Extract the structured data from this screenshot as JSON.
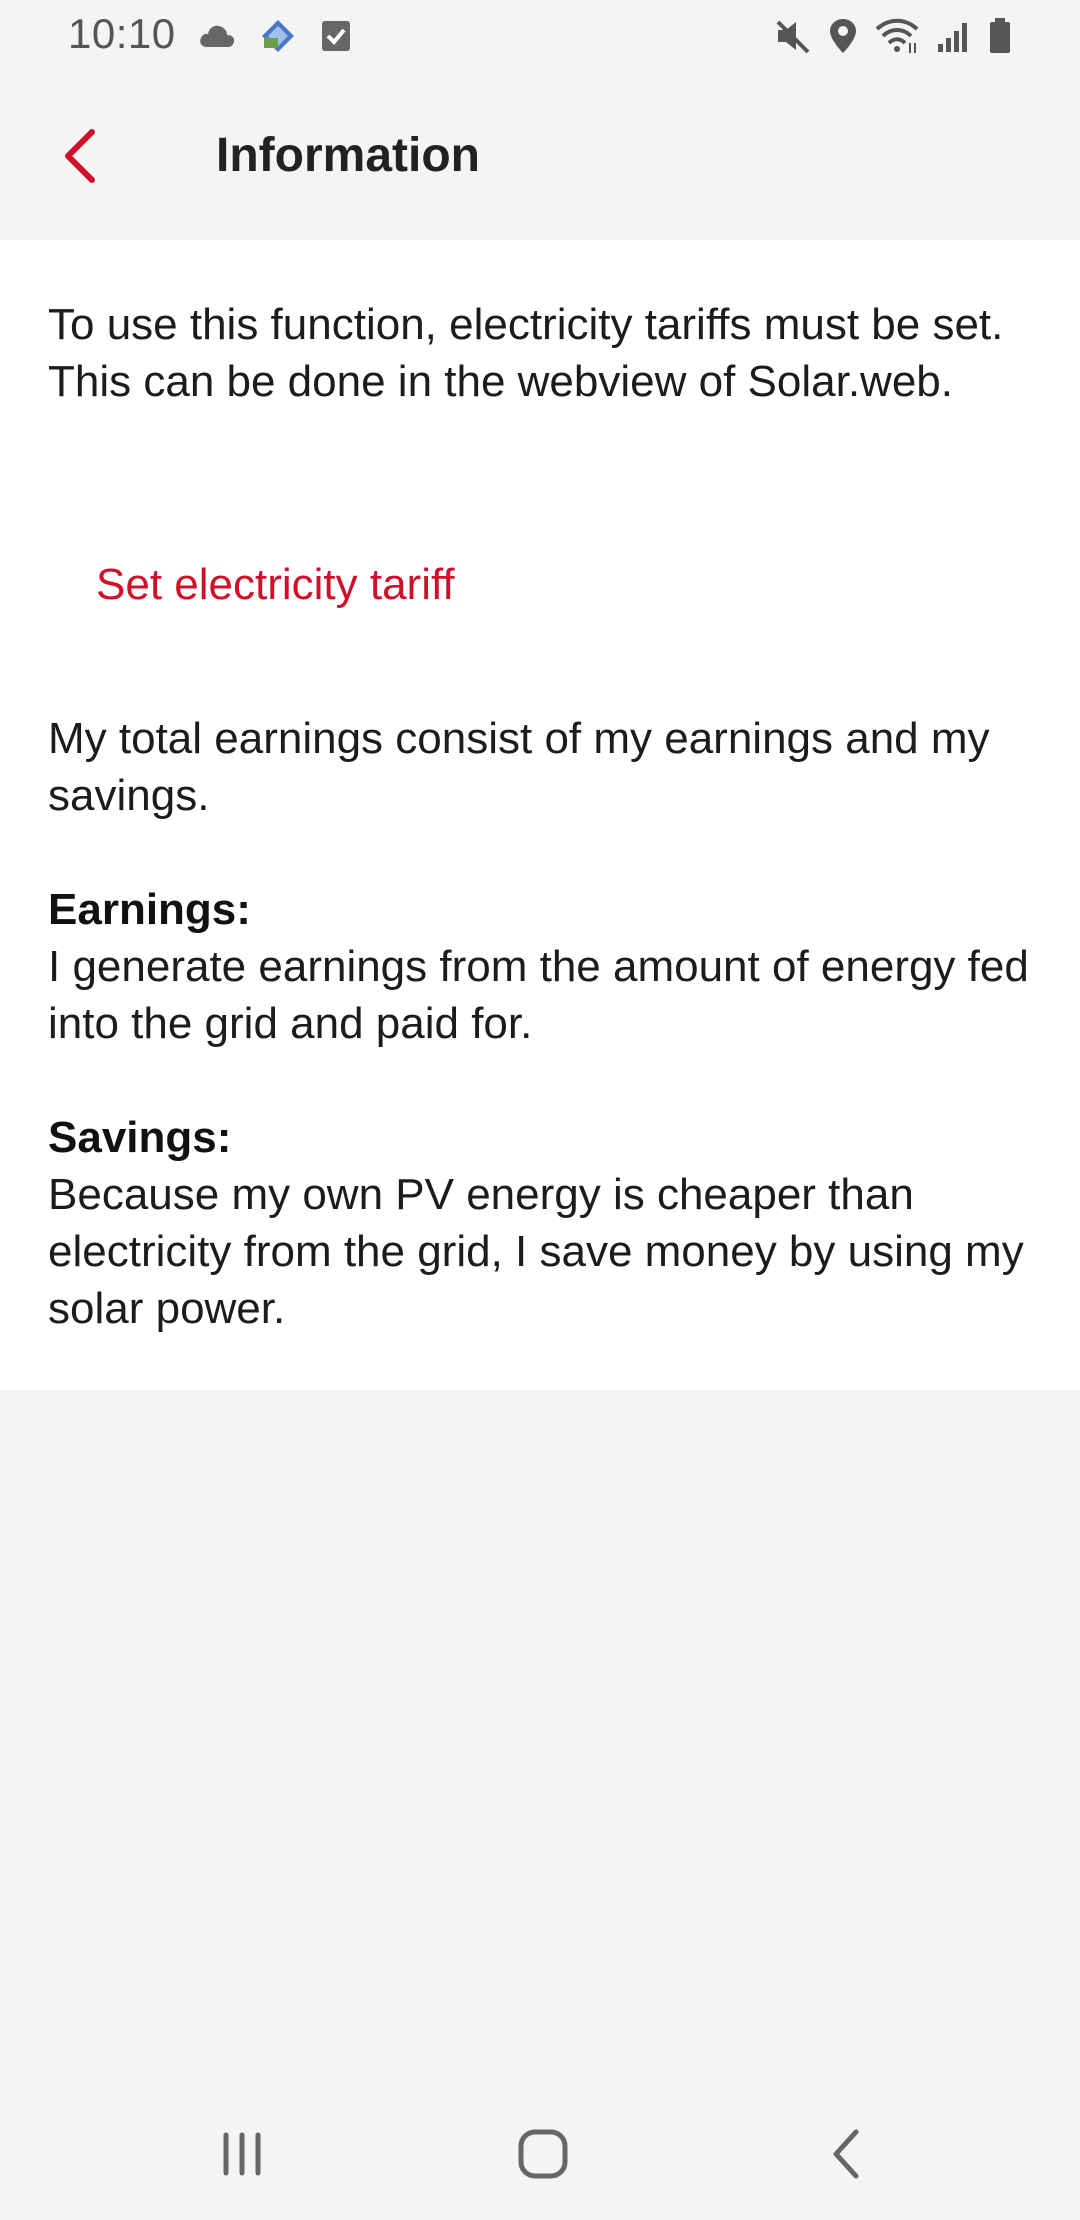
{
  "status_bar": {
    "time": "10:10",
    "left_icons": [
      "cloud-icon",
      "app-notification-icon",
      "checkbox-notification-icon"
    ],
    "right_icons": [
      "mute-icon",
      "location-icon",
      "wifi-icon",
      "signal-icon",
      "battery-icon"
    ]
  },
  "app_bar": {
    "title": "Information",
    "back_icon": "chevron-left-icon"
  },
  "content": {
    "intro": "To use this function, electricity tariffs must be set. This can be done in the webview of Solar.web.",
    "set_tariff_link": "Set electricity tariff",
    "total_earnings": "My total earnings consist of my earnings and my savings.",
    "earnings_heading": "Earnings:",
    "earnings_text": "I generate earnings from the amount of energy fed into the grid and paid for.",
    "savings_heading": "Savings:",
    "savings_text": "Because my own PV energy is cheaper than electricity from the grid, I save money by using my solar power."
  },
  "nav_bar": {
    "buttons": [
      "recents-icon",
      "home-icon",
      "back-icon"
    ]
  },
  "colors": {
    "accent": "#d0102a",
    "background": "#f4f4f4",
    "card": "#ffffff",
    "text": "#1c1c1c"
  }
}
